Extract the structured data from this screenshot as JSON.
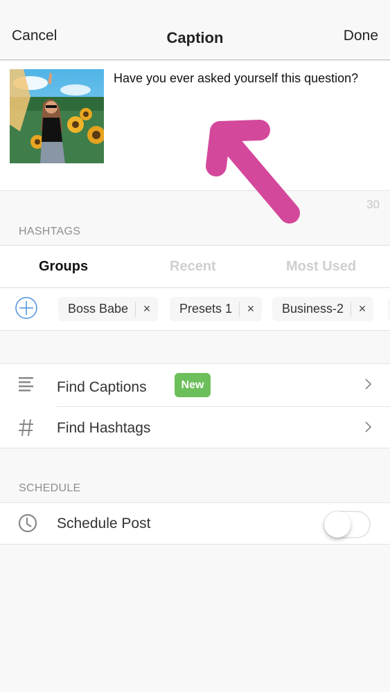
{
  "navbar": {
    "cancel_label": "Cancel",
    "title": "Caption",
    "done_label": "Done"
  },
  "caption": {
    "image_alt": "Photo of a woman in a sunflower field",
    "text": "Have you ever asked yourself this question?",
    "char_count": "30"
  },
  "hashtags": {
    "section_label": "HASHTAGS",
    "tabs": [
      {
        "label": "Groups",
        "active": true
      },
      {
        "label": "Recent",
        "active": false
      },
      {
        "label": "Most Used",
        "active": false
      }
    ],
    "add_icon": "plus-circle-icon",
    "groups": [
      {
        "label": "Boss Babe"
      },
      {
        "label": "Presets 1"
      },
      {
        "label": "Business-2"
      }
    ]
  },
  "tools": {
    "items": [
      {
        "label": "Find Captions",
        "icon": "text-lines-icon",
        "badge": "New"
      },
      {
        "label": "Find Hashtags",
        "icon": "hash-icon"
      }
    ]
  },
  "schedule": {
    "section_label": "SCHEDULE",
    "item_label": "Schedule Post",
    "icon": "clock-icon",
    "toggle_on": false
  },
  "colors": {
    "badge_green": "#6cbf5a",
    "accent_blue": "#4a90d9",
    "annotation_pink": "#d4489c"
  }
}
